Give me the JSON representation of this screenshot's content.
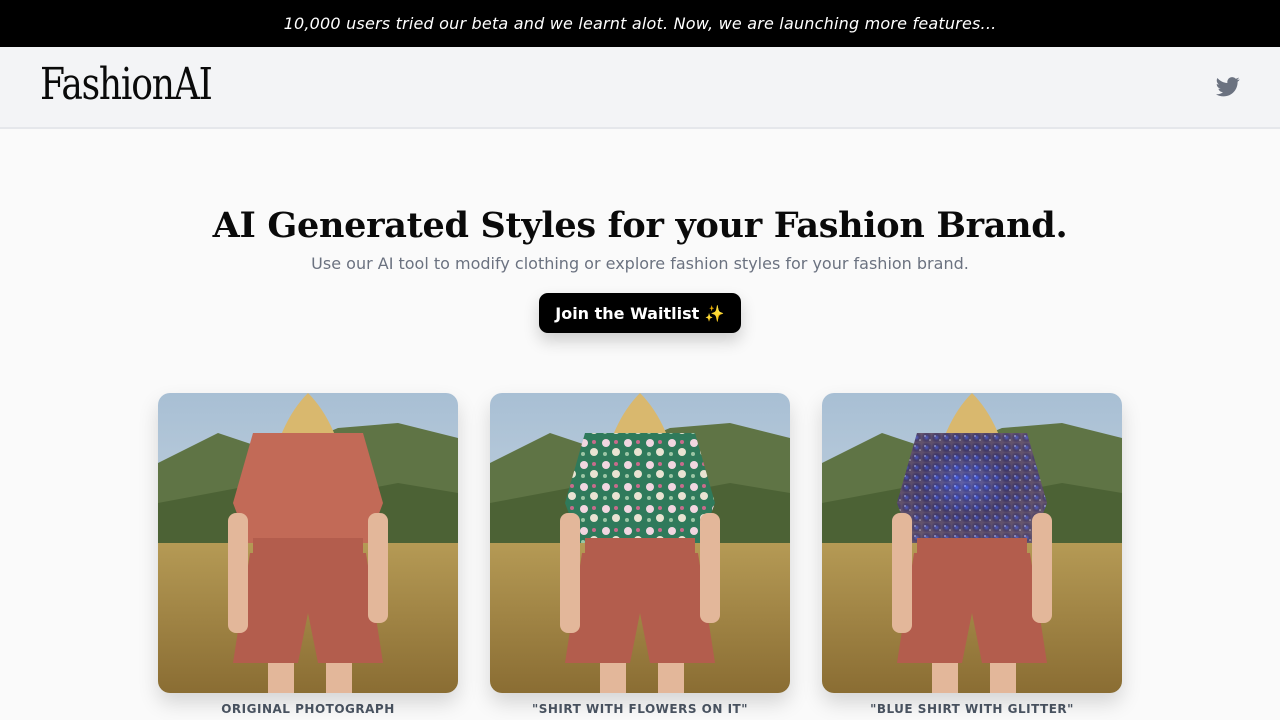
{
  "announcement": "10,000 users tried our beta and we learnt alot. Now, we are launching more features...",
  "header": {
    "logo": "FashionAI",
    "social_icon": "twitter-icon"
  },
  "hero": {
    "title": "AI Generated Styles for your Fashion Brand.",
    "subtitle": "Use our AI tool to modify clothing or explore fashion styles for your fashion brand.",
    "cta_label": "Join the Waitlist ✨"
  },
  "gallery": [
    {
      "caption": "ORIGINAL PHOTOGRAPH",
      "shirt": "plain terracotta shirt",
      "shirt_color": "#c26a57"
    },
    {
      "caption": "\"SHIRT WITH FLOWERS ON IT\"",
      "shirt": "floral green shirt",
      "shirt_color": "#2f7a5b"
    },
    {
      "caption": "\"BLUE SHIRT WITH GLITTER\"",
      "shirt": "blue glitter shirt",
      "shirt_color": "#3d3566"
    }
  ]
}
